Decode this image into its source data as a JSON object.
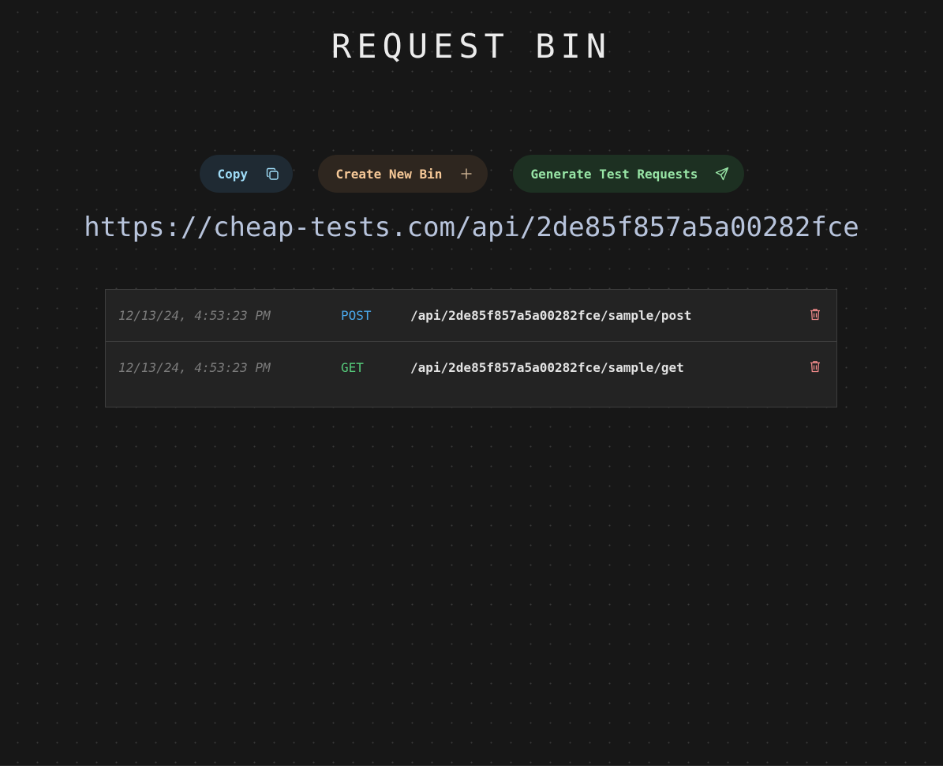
{
  "app": {
    "title": "REQUEST BIN"
  },
  "toolbar": {
    "copy_label": "Copy",
    "copy_icon": "copy-icon",
    "create_label": "Create New Bin",
    "create_icon": "plus-icon",
    "generate_label": "Generate Test Requests",
    "generate_icon": "send-icon"
  },
  "bin": {
    "url": "https://cheap-tests.com/api/2de85f857a5a00282fce"
  },
  "requests": [
    {
      "timestamp": "12/13/24, 4:53:23 PM",
      "method": "POST",
      "path": "/api/2de85f857a5a00282fce/sample/post",
      "delete_icon": "trash-icon"
    },
    {
      "timestamp": "12/13/24, 4:53:23 PM",
      "method": "GET",
      "path": "/api/2de85f857a5a00282fce/sample/get",
      "delete_icon": "trash-icon"
    }
  ],
  "colors": {
    "background": "#171717",
    "post_method": "#4aa8ec",
    "get_method": "#55c97a",
    "delete": "#f08a8a",
    "url": "#b8c4dc"
  }
}
